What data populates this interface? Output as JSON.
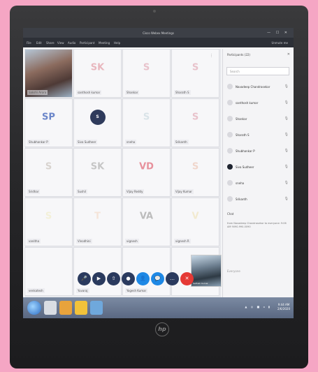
{
  "app": {
    "title": "Cisco Webex Meetings",
    "window_controls": "— ☐ ✕"
  },
  "menu": {
    "items": [
      "File",
      "Edit",
      "Share",
      "View",
      "Audio",
      "Participant",
      "Meeting",
      "Help"
    ],
    "unmute": "Unmute me"
  },
  "tiles": [
    {
      "label": "Sakshi Arora",
      "initials": "",
      "color": ""
    },
    {
      "label": "santhosh kumar",
      "initials": "SK",
      "color": "#e8b7be"
    },
    {
      "label": "Shankar",
      "initials": "S",
      "color": "#e8c2cb"
    },
    {
      "label": "Sharath S",
      "initials": "S",
      "color": "#e8c2cb"
    },
    {
      "label": "Shubhankar P",
      "initials": "SP",
      "color": "#6b86c9"
    },
    {
      "label": "Siva Sudheer",
      "initials": "S",
      "color": "#2f3b5c"
    },
    {
      "label": "sneha",
      "initials": "S",
      "color": "#d9e3e8"
    },
    {
      "label": "Srikanth",
      "initials": "S",
      "color": "#e8c2cb"
    },
    {
      "label": "Sridhar",
      "initials": "S",
      "color": "#d8d3cf"
    },
    {
      "label": "Sushil",
      "initials": "SK",
      "color": "#c6c6c6"
    },
    {
      "label": "Vijay Reddy",
      "initials": "VD",
      "color": "#e7919c"
    },
    {
      "label": "Vijay Kumar",
      "initials": "S",
      "color": "#f0d6cc"
    },
    {
      "label": "vanitha",
      "initials": "S",
      "color": "#f3f0d8"
    },
    {
      "label": "Vinodhini",
      "initials": "T",
      "color": "#f5e4d9"
    },
    {
      "label": "vignesh",
      "initials": "VA",
      "color": "#bcbcbc"
    },
    {
      "label": "vignesh R",
      "initials": "V",
      "color": "#f2ead0"
    },
    {
      "label": "venkatesh",
      "initials": "",
      "color": ""
    },
    {
      "label": "Yuvaraj",
      "initials": "",
      "color": ""
    },
    {
      "label": "Yogesh Kumar",
      "initials": "",
      "color": ""
    },
    {
      "label": "",
      "initials": "",
      "color": ""
    }
  ],
  "self_view": {
    "label": "Sathish Kumar"
  },
  "toolbar": {
    "buttons": [
      {
        "icon": "mute-icon",
        "glyph": "🎤",
        "color": "#2a3a5e"
      },
      {
        "icon": "video-icon",
        "glyph": "▶",
        "color": "#2a3a5e"
      },
      {
        "icon": "share-icon",
        "glyph": "⇧",
        "color": "#2a3a5e"
      },
      {
        "icon": "record-icon",
        "glyph": "●",
        "color": "#2a3a5e"
      },
      {
        "icon": "participants-icon",
        "glyph": "👤",
        "color": "#1e88e5"
      },
      {
        "icon": "chat-icon",
        "glyph": "💬",
        "color": "#1e88e5"
      },
      {
        "icon": "more-icon",
        "glyph": "…",
        "color": "#2a3a5e"
      },
      {
        "icon": "leave-icon",
        "glyph": "✕",
        "color": "#e53935"
      }
    ]
  },
  "participants_panel": {
    "title": "Participants (22)",
    "search_placeholder": "Search",
    "list": [
      {
        "name": "Navadeep Chandrasekar",
        "dark": false
      },
      {
        "name": "santhosh kumar",
        "dark": false
      },
      {
        "name": "Shankar",
        "dark": false
      },
      {
        "name": "Sharath S",
        "dark": false
      },
      {
        "name": "Shubhankar P",
        "dark": false
      },
      {
        "name": "Siva Sudheer",
        "dark": true
      },
      {
        "name": "sneha",
        "dark": false
      },
      {
        "name": "Srikanth",
        "dark": false
      }
    ],
    "chat_title": "Chat",
    "chat_message": "from Navadeep Chandrasekar to everyone: 9:06 AM 9090-990-0090",
    "chat_input": "Everyone"
  },
  "taskbar": {
    "apps": [
      "#d9dde4",
      "#e8a33c",
      "#f2c23a",
      "#6fa8dc"
    ],
    "tray": "▲ ◎ ■ ◂ ▮",
    "time": "9:44 AM",
    "date": "2/6/2020"
  },
  "laptop": {
    "brand": "hp"
  }
}
